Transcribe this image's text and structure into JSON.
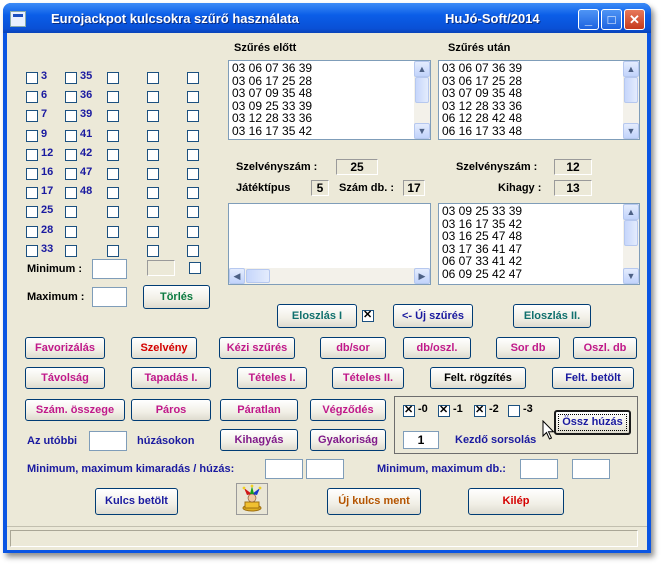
{
  "window": {
    "title": "Eurojackpot kulcsokra szűrő használata",
    "brand": "HuJó-Soft/2014",
    "minimize_glyph": "_",
    "maximize_glyph": "□",
    "close_glyph": "✕"
  },
  "number_grid": {
    "col1": [
      "3",
      "6",
      "7",
      "9",
      "12",
      "16",
      "17",
      "25",
      "28",
      "33"
    ],
    "col2": [
      "35",
      "36",
      "39",
      "41",
      "42",
      "47",
      "48",
      "",
      "",
      ""
    ]
  },
  "minmax": {
    "minimum_label": "Minimum :",
    "maximum_label": "Maximum :",
    "torles_label": "Törlés"
  },
  "before": {
    "header": "Szűrés előtt",
    "lines": [
      "03 06 07 36 39",
      "03 06 17 25 28",
      "03 07 09 35 48",
      "03 09 25 33 39",
      "03 12 28 33 36",
      "03 16 17 35 42"
    ],
    "szelvenyszam_label": "Szelvényszám :",
    "szelvenyszam_value": "25",
    "jatektipus_label": "Játéktípus",
    "jatektipus_value": "5",
    "szam_db_label": "Szám db. :",
    "szam_db_value": "17"
  },
  "after": {
    "header": "Szűrés után",
    "lines": [
      "03 06 07 36 39",
      "03 06 17 25 28",
      "03 07 09 35 48",
      "03 12 28 33 36",
      "06 12 28 42 48",
      "06 16 17 33 48"
    ],
    "szelvenyszam_label": "Szelvényszám :",
    "szelvenyszam_value": "12",
    "kihagy_label": "Kihagy :",
    "kihagy_value": "13",
    "skipped_lines": [
      "03 09 25 33 39",
      "03 16 17 35 42",
      "03 16 25 47 48",
      "03 17 36 41 47",
      "06 07 33 41 42",
      "06 09 25 42 47"
    ]
  },
  "mid_buttons": {
    "eloszlas1": "Eloszlás I",
    "uj_szures": "<- Új szűrés",
    "eloszlas2": "Eloszlás II."
  },
  "buttons_row1": [
    "Favorizálás",
    "Szelvény",
    "Kézi szűrés",
    "db/sor",
    "db/oszl.",
    "Sor db",
    "Oszl. db"
  ],
  "buttons_row2": [
    "Távolság",
    "Tapadás I.",
    "Tételes I.",
    "Tételes II.",
    "Felt. rögzítés",
    "Felt. betölt"
  ],
  "buttons_row3": [
    "Szám. összege",
    "Páros",
    "Páratlan",
    "Végződés"
  ],
  "buttons_row4": {
    "kihagyas": "Kihagyás",
    "gyakorisag": "Gyakoriság"
  },
  "utobbi": {
    "prefix": "Az utóbbi",
    "suffix": "húzásokon"
  },
  "shift_group": {
    "options": [
      {
        "label": "-0",
        "checked": true
      },
      {
        "label": "-1",
        "checked": true
      },
      {
        "label": "-2",
        "checked": true
      },
      {
        "label": "-3",
        "checked": false
      }
    ],
    "kezdo_value": "1",
    "kezdo_label": "Kezdő sorsolás",
    "ossz_huzas": "Össz húzás"
  },
  "bottom_labels": {
    "kimaradas": "Minimum, maximum kimaradás / húzás:",
    "max_db": "Minimum, maximum db.:"
  },
  "bottom_buttons": {
    "kulcs_betolt": "Kulcs betölt",
    "uj_kulcs_ment": "Új kulcs ment",
    "kilep": "Kilép"
  },
  "icons": {
    "jester": "jester-icon"
  }
}
